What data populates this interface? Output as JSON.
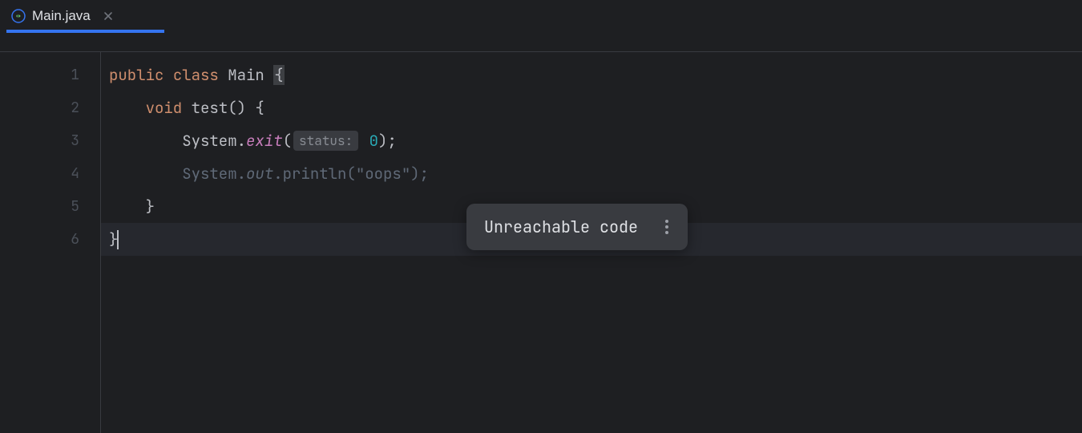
{
  "tabs": {
    "active": {
      "filename": "Main.java",
      "icon": "java-class-icon"
    }
  },
  "editor": {
    "lineNumbers": [
      "1",
      "2",
      "3",
      "4",
      "5",
      "6"
    ],
    "lines": {
      "l1": {
        "public": "public",
        "class": "class",
        "name": "Main",
        "brace": "{"
      },
      "l2": {
        "indent": "    ",
        "void": "void",
        "method": "test",
        "parens": "() {"
      },
      "l3": {
        "indent": "        ",
        "obj": "System.",
        "member": "exit",
        "open": "(",
        "hint": "status:",
        "arg": "0",
        "close": ");"
      },
      "l4": {
        "indent": "        ",
        "obj": "System.",
        "member": "out",
        "method": ".println(",
        "str": "\"oops\"",
        "close": ");"
      },
      "l5": {
        "indent": "    ",
        "brace": "}"
      },
      "l6": {
        "brace": "}"
      }
    }
  },
  "tooltip": {
    "message": "Unreachable code"
  }
}
